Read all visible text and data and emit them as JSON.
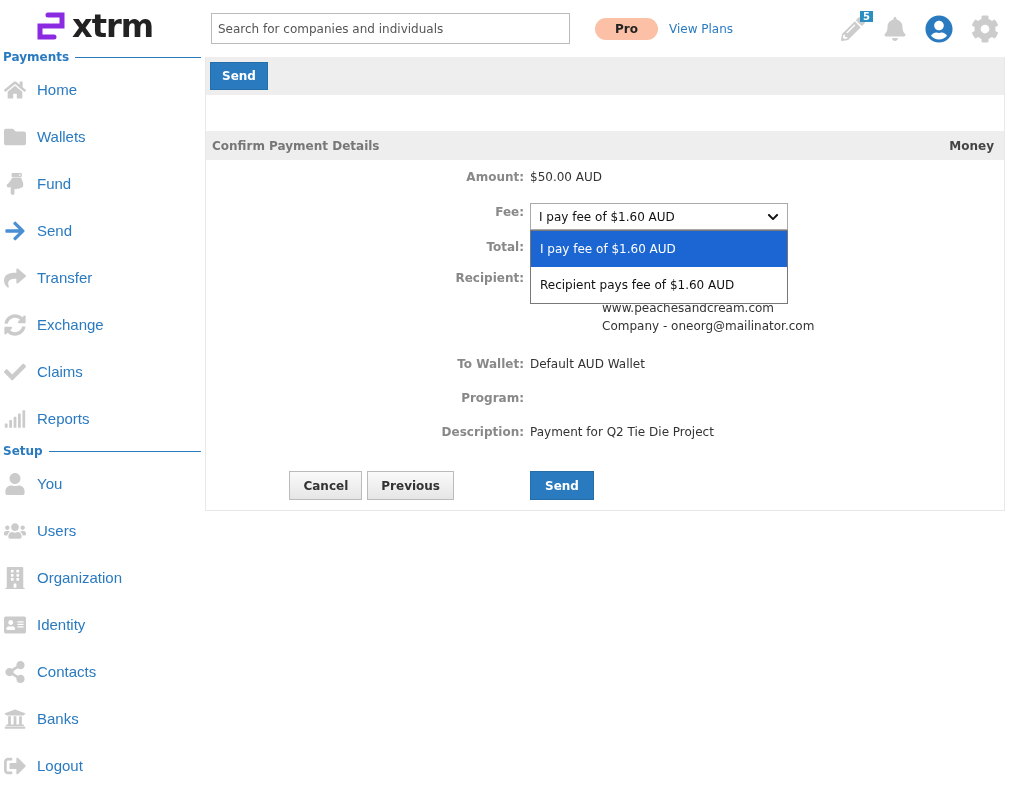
{
  "logo": {
    "text": "xtrm"
  },
  "sidebar": {
    "sections": [
      {
        "title": "Payments",
        "items": [
          {
            "label": "Home",
            "selected": false
          },
          {
            "label": "Wallets",
            "selected": false
          },
          {
            "label": "Fund",
            "selected": false
          },
          {
            "label": "Send",
            "selected": true
          },
          {
            "label": "Transfer",
            "selected": false
          },
          {
            "label": "Exchange",
            "selected": false
          },
          {
            "label": "Claims",
            "selected": false
          },
          {
            "label": "Reports",
            "selected": false
          }
        ]
      },
      {
        "title": "Setup",
        "items": [
          {
            "label": "You",
            "selected": false
          },
          {
            "label": "Users",
            "selected": false
          },
          {
            "label": "Organization",
            "selected": false
          },
          {
            "label": "Identity",
            "selected": false
          },
          {
            "label": "Contacts",
            "selected": false
          },
          {
            "label": "Banks",
            "selected": false
          },
          {
            "label": "Logout",
            "selected": false
          }
        ]
      }
    ]
  },
  "topbar": {
    "search": {
      "placeholder": "Search for companies and individuals"
    },
    "plan_badge": "Pro",
    "plans_link": "View Plans",
    "notes_count": "5"
  },
  "toolbar": {
    "button": "Send"
  },
  "section": {
    "title": "Confirm Payment Details",
    "right": "Money"
  },
  "fields": [
    {
      "label": "Amount:",
      "values": [
        "$50.00 AUD"
      ]
    },
    {
      "label": "Fee:",
      "kind": "select"
    },
    {
      "label": "Total:"
    },
    {
      "label": "Recipient:",
      "values": [
        "www.peachesandcream.com",
        "Company - oneorg@mailinator.com"
      ]
    },
    {
      "label": "To Wallet:",
      "values": [
        "Default AUD Wallet"
      ]
    },
    {
      "label": "Program:"
    },
    {
      "label": "Description:",
      "values": [
        "Payment for Q2 Tie Die Project"
      ]
    }
  ],
  "fee_select": {
    "value": "I pay fee of $1.60 AUD",
    "expanded": true,
    "options": [
      {
        "label": "I pay fee of $1.60 AUD",
        "selected": true
      },
      {
        "label": "Recipient pays fee of $1.60 AUD",
        "selected": false
      }
    ]
  },
  "actions": {
    "cancel": "Cancel",
    "previous": "Previous",
    "send": "Send"
  }
}
